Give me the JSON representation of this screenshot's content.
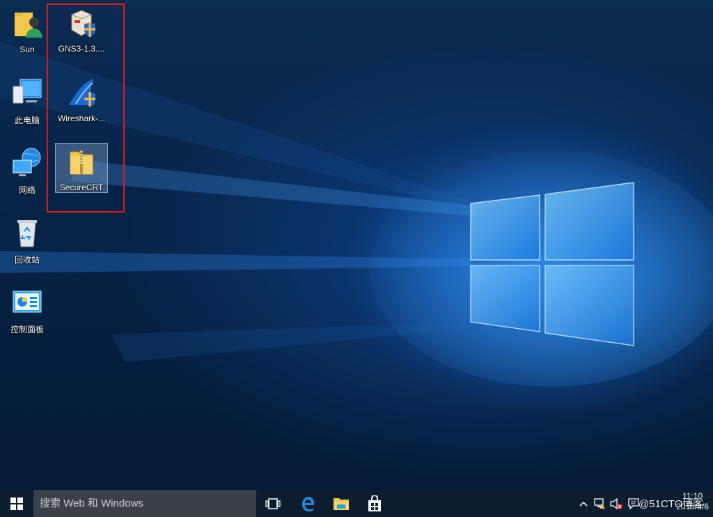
{
  "desktop": {
    "icons": [
      {
        "label": "Sun",
        "icon": "user-folder-icon"
      },
      {
        "label": "此电脑",
        "icon": "computer-icon"
      },
      {
        "label": "网络",
        "icon": "network-icon"
      },
      {
        "label": "回收站",
        "icon": "recycle-bin-icon"
      },
      {
        "label": "控制面板",
        "icon": "control-panel-icon"
      },
      {
        "label": "GNS3-1.3....",
        "icon": "installer-icon"
      },
      {
        "label": "Wireshark-...",
        "icon": "wireshark-installer-icon"
      },
      {
        "label": "SecureCRT",
        "icon": "zip-folder-icon",
        "selected": true
      }
    ],
    "highlight_color": "#e0191f"
  },
  "taskbar": {
    "search_placeholder": "搜索 Web 和 Windows",
    "pinned": [
      "task-view-icon",
      "edge-icon",
      "file-explorer-icon",
      "store-icon"
    ],
    "tray_icons": [
      "chevron-up-icon",
      "network-error-icon",
      "volume-muted-icon",
      "action-center-icon"
    ],
    "clock_time": "11:10",
    "clock_date": "2015/8/6"
  },
  "watermark": "@51CTO博客",
  "colors": {
    "taskbar": "#0c1d2f",
    "search": "#3a4048",
    "accent": "#1e90ff"
  }
}
